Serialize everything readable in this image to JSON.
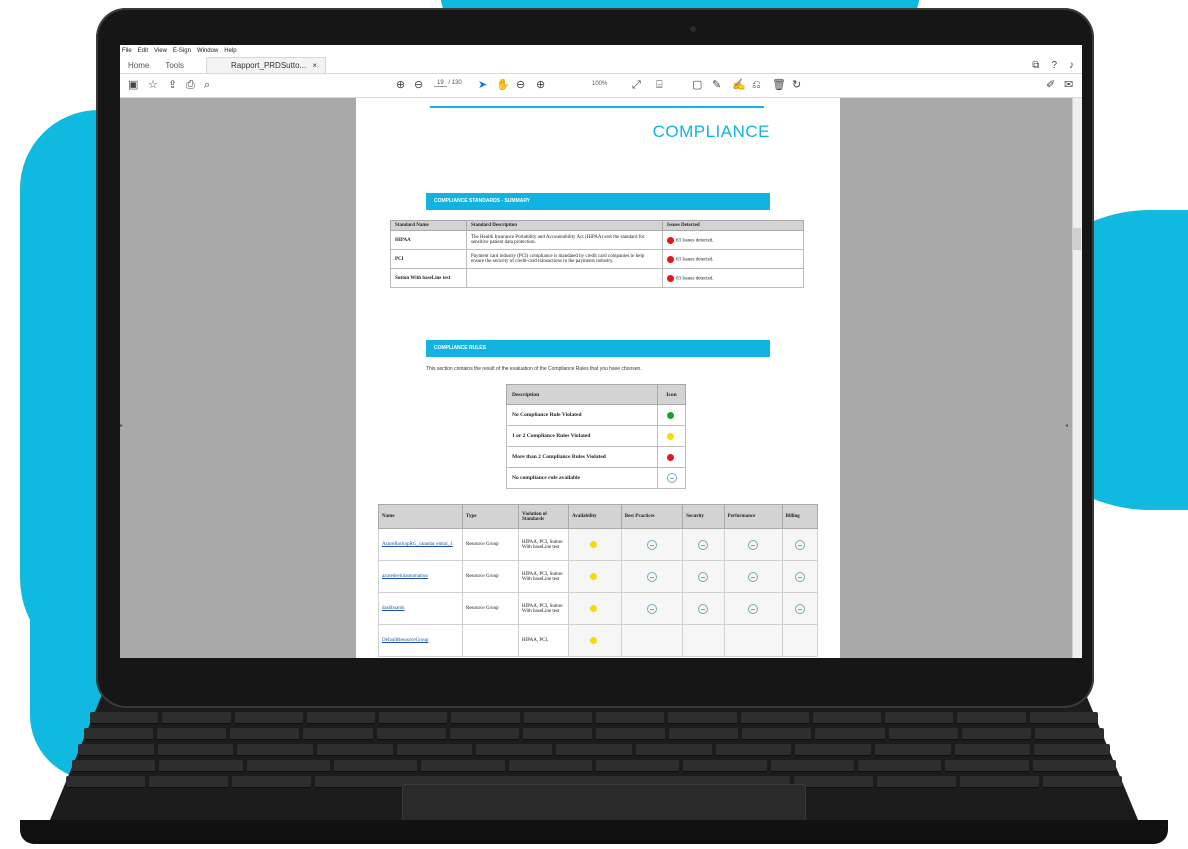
{
  "menu": [
    "File",
    "Edit",
    "View",
    "E-Sign",
    "Window",
    "Help"
  ],
  "tabs": {
    "home": "Home",
    "tools": "Tools",
    "document": "Rapport_PRDSutto...",
    "close": "×"
  },
  "toolbar": {
    "page_current": "19",
    "page_total": "/ 130",
    "zoom": "100%"
  },
  "colors": {
    "accent": "#12b3e0",
    "red": "#e8141c",
    "green": "#16a12c",
    "yellow": "#f6dc00"
  },
  "page": {
    "title": "COMPLIANCE",
    "standards_band": "COMPLIANCE STANDARDS - SUMMARY",
    "standards_headers": [
      "Standard Name",
      "Standard Description",
      "Issues Detected"
    ],
    "standards_rows": [
      {
        "name": "HIPAA",
        "desc": "The Health Insurance Portability and Accountability Act (HIPAA) sets the standard for sensitive patient data protection.",
        "issues": "63 Issues detected."
      },
      {
        "name": "PCI",
        "desc": "Payment card industry (PCI) compliance is mandated by credit card companies to help ensure the security of credit-card transactions in the payments industry.",
        "issues": "63 Issues detected."
      },
      {
        "name": "Sutton With baseLine test",
        "desc": "",
        "issues": "63 Issues detected."
      }
    ],
    "rules_band": "COMPLIANCE RULES",
    "rules_intro": "This section contains the result of the evaluation of the Compliance Rules that you have choosen.",
    "legend_headers": [
      "Description",
      "Icon"
    ],
    "legend_rows": [
      {
        "label": "No Compliance Rule Violated",
        "icon": "green"
      },
      {
        "label": "1 or 2 Compliance Rules Violated",
        "icon": "yellow"
      },
      {
        "label": "More than 2 Compliance Rules Violated",
        "icon": "red"
      },
      {
        "label": "No compliance rule available",
        "icon": "none"
      }
    ],
    "resource_headers": [
      "Name",
      "Type",
      "Violation of Standards",
      "Availability",
      "Best Practices",
      "Security",
      "Performance",
      "Billing"
    ],
    "resource_rows": [
      {
        "name": "AzureBackupRG_canadac entral_1",
        "type": "Resource Group",
        "violation": "HIPAA, PCI, Sutton With baseLine test"
      },
      {
        "name": "azuredevkitautomation",
        "type": "Resource Group",
        "violation": "HIPAA, PCI, Sutton With baseLine test"
      },
      {
        "name": "dashboards",
        "type": "Resource Group",
        "violation": "HIPAA, PCI, Sutton With baseLine test"
      },
      {
        "name": "DefaultResourceGroup",
        "type": "",
        "violation": "HIPAA, PCI,"
      }
    ]
  }
}
